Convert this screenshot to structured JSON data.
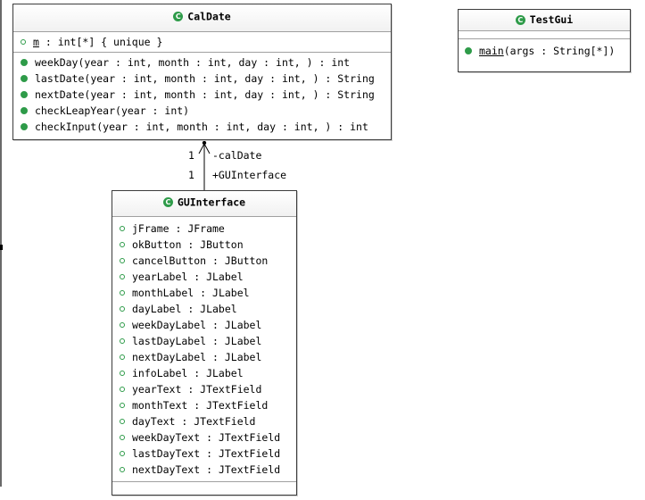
{
  "diagram": {
    "classes": {
      "caldate": {
        "name": "CalDate",
        "attributes": [
          {
            "name": "m",
            "type": " : int[*] { unique }"
          }
        ],
        "operations": [
          {
            "name": "weekDay",
            "sig": "(year : int, month : int, day : int, ) : int"
          },
          {
            "name": "lastDate",
            "sig": "(year : int, month : int, day : int, ) : String"
          },
          {
            "name": "nextDate",
            "sig": "(year : int, month : int, day : int, ) : String"
          },
          {
            "name": "checkLeapYear",
            "sig": "(year : int)"
          },
          {
            "name": "checkInput",
            "sig": "(year : int, month : int, day : int, ) : int"
          }
        ]
      },
      "testgui": {
        "name": "TestGui",
        "operations": [
          {
            "name": "main",
            "sig": "(args : String[*])"
          }
        ]
      },
      "guinterface": {
        "name": "GUInterface",
        "attributes": [
          {
            "name": "jFrame",
            "type": " : JFrame"
          },
          {
            "name": "okButton",
            "type": " : JButton"
          },
          {
            "name": "cancelButton",
            "type": " : JButton"
          },
          {
            "name": "yearLabel",
            "type": " : JLabel"
          },
          {
            "name": "monthLabel",
            "type": " : JLabel"
          },
          {
            "name": "dayLabel",
            "type": " : JLabel"
          },
          {
            "name": "weekDayLabel",
            "type": " : JLabel"
          },
          {
            "name": "lastDayLabel",
            "type": " : JLabel"
          },
          {
            "name": "nextDayLabel",
            "type": " : JLabel"
          },
          {
            "name": "infoLabel",
            "type": " : JLabel"
          },
          {
            "name": "yearText",
            "type": " : JTextField"
          },
          {
            "name": "monthText",
            "type": " : JTextField"
          },
          {
            "name": "dayText",
            "type": " : JTextField"
          },
          {
            "name": "weekDayText",
            "type": " : JTextField"
          },
          {
            "name": "lastDayText",
            "type": " : JTextField"
          },
          {
            "name": "nextDayText",
            "type": " : JTextField"
          }
        ]
      }
    },
    "association": {
      "top_multiplicity": "1",
      "top_role": "-calDate",
      "bottom_multiplicity": "1",
      "bottom_role": "+GUInterface"
    },
    "class_icon": "C",
    "colors": {
      "icon": "#2e9b49",
      "border": "#3c3c3c"
    }
  }
}
